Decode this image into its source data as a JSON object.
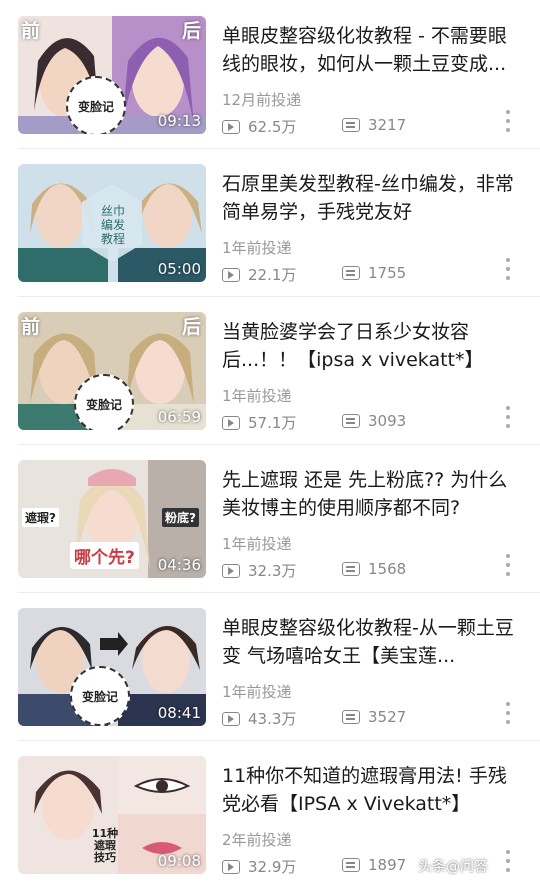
{
  "videos": [
    {
      "title": "单眼皮整容级化妆教程 - 不需要眼线的眼妆，如何从一颗土豆变成...",
      "posted": "12月前投递",
      "views": "62.5万",
      "comments": "3217",
      "duration": "09:13",
      "left_tag": "前",
      "right_tag": "后",
      "badge": "变脸记",
      "bg": "#e8d7e6",
      "accent": "#8e5fb0"
    },
    {
      "title": "石原里美发型教程-丝巾编发，非常简单易学，手残党友好",
      "posted": "1年前投递",
      "views": "22.1万",
      "comments": "1755",
      "duration": "05:00",
      "overlay": "丝巾编发教程",
      "bg": "#cfe0ea",
      "accent": "#2f6d6a"
    },
    {
      "title": "当黄脸婆学会了日系少女妆容后...！！【ipsa x vivekatt*】",
      "posted": "1年前投递",
      "views": "57.1万",
      "comments": "3093",
      "duration": "06:59",
      "left_tag": "前",
      "right_tag": "后",
      "badge": "变脸记",
      "bg": "#d9cdb8",
      "accent": "#3c7a70"
    },
    {
      "title": "先上遮瑕 还是 先上粉底?? 为什么美妆博主的使用顺序都不同?",
      "posted": "1年前投递",
      "views": "32.3万",
      "comments": "1568",
      "duration": "04:36",
      "tag1": "遮瑕?",
      "tag2": "粉底?",
      "question": "哪个先?",
      "bg": "#e9e3de",
      "accent": "#c93c46"
    },
    {
      "title": "单眼皮整容级化妆教程-从一颗土豆 变 气场嘻哈女王【美宝莲...",
      "posted": "1年前投递",
      "views": "43.3万",
      "comments": "3527",
      "duration": "08:41",
      "badge": "变脸记",
      "bg": "#d9dbe0",
      "accent": "#3c4a6b"
    },
    {
      "title": "11种你不知道的遮瑕膏用法! 手残党必看【IPSA x Vivekatt*】",
      "posted": "2年前投递",
      "views": "32.9万",
      "comments": "1897",
      "duration": "09:08",
      "overlay": "11种遮瑕技巧",
      "bg": "#f0e4e0",
      "accent": "#d75a78"
    }
  ],
  "watermark": "头条@问答"
}
